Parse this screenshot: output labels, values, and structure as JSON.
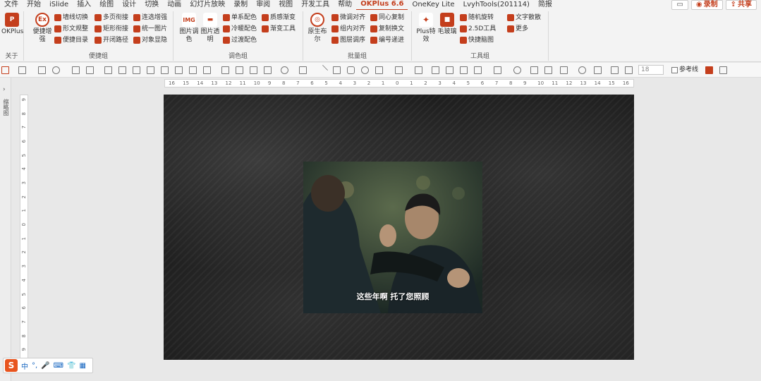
{
  "menu": {
    "items": [
      "文件",
      "开始",
      "iSlide",
      "插入",
      "绘图",
      "设计",
      "切换",
      "动画",
      "幻灯片放映",
      "录制",
      "审阅",
      "视图",
      "开发工具",
      "帮助",
      "OKPlus 6.6",
      "OneKey Lite",
      "LvyhTools(201114)",
      "简报"
    ],
    "active_index": 14,
    "record_label": "录制",
    "share_label": "共享"
  },
  "ribbon": {
    "about": {
      "button_label": "OKPlus",
      "group_label": "关于"
    },
    "quick": {
      "big_label": "便捷增强",
      "small": [
        "墙线切换",
        "形文规整",
        "便捷目录",
        "多页衔接",
        "矩形衔接",
        "开闭路径",
        "连选增强",
        "统一图片",
        "对象显隐"
      ],
      "group_label": "便捷组"
    },
    "color": {
      "img_label": "图片调色",
      "trans_label": "图片透明",
      "small": [
        "单系配色",
        "冷暖配色",
        "过渡配色",
        "质感渐变",
        "渐变工具"
      ],
      "group_label": "调色组"
    },
    "batch": {
      "big_label": "原生布尔",
      "small": [
        "微调对齐",
        "组内对齐",
        "图层调序",
        "同心复制",
        "复制换文",
        "编号递进"
      ],
      "group_label": "批量组"
    },
    "tools": {
      "plus_label": "Plus特效",
      "glass_label": "毛玻璃",
      "small": [
        "随机旋转",
        "2.5D工具",
        "快捷脑图",
        "文字散散",
        "更多"
      ],
      "group_label": "工具组"
    }
  },
  "toolbar": {
    "zoom_value": "18",
    "guides_label": "参考线"
  },
  "leftpane": {
    "label": "缩略图"
  },
  "ruler": {
    "h_ticks": [
      "16",
      "15",
      "14",
      "13",
      "12",
      "11",
      "10",
      "9",
      "8",
      "7",
      "6",
      "5",
      "4",
      "3",
      "2",
      "1",
      "0",
      "1",
      "2",
      "3",
      "4",
      "5",
      "6",
      "7",
      "8",
      "9",
      "10",
      "11",
      "12",
      "13",
      "14",
      "15",
      "16"
    ],
    "v_ticks": [
      "9",
      "8",
      "7",
      "6",
      "5",
      "4",
      "3",
      "2",
      "1",
      "0",
      "1",
      "2",
      "3",
      "4",
      "5",
      "6",
      "7",
      "8",
      "9"
    ]
  },
  "slide": {
    "caption": "这些年啊 托了您照顾"
  },
  "ime": {
    "items": [
      "中",
      "°,",
      "🎤",
      "⌨",
      "👕",
      "▦"
    ]
  }
}
